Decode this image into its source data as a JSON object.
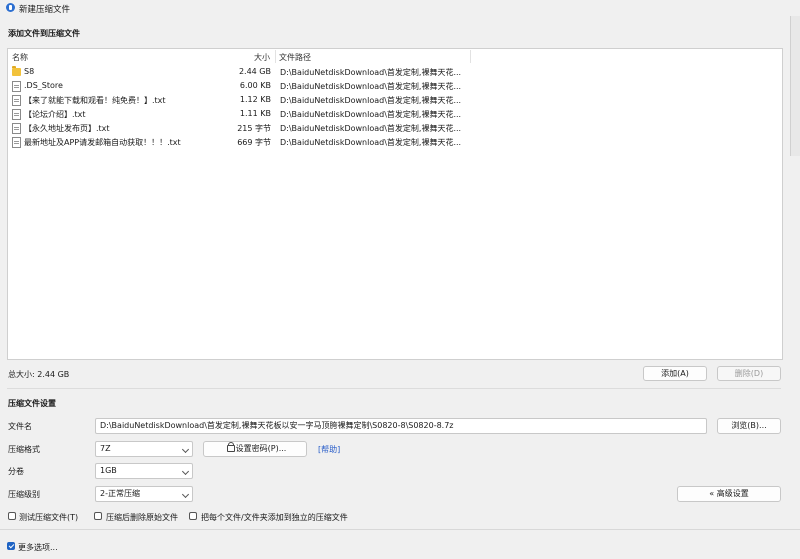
{
  "window": {
    "title": "新建压缩文件"
  },
  "add_section": {
    "heading": "添加文件到压缩文件",
    "columns": {
      "name": "名称",
      "size": "大小",
      "path": "文件路径"
    },
    "rows": [
      {
        "icon": "folder-icon",
        "name": "S8",
        "size": "2.44 GB",
        "path": "D:\\BaiduNetdiskDownload\\首发定制,裸舞天花..."
      },
      {
        "icon": "file-icon",
        "name": ".DS_Store",
        "size": "6.00 KB",
        "path": "D:\\BaiduNetdiskDownload\\首发定制,裸舞天花..."
      },
      {
        "icon": "text-file-icon",
        "name": "【来了就能下载和观看！纯免费！】.txt",
        "size": "1.12 KB",
        "path": "D:\\BaiduNetdiskDownload\\首发定制,裸舞天花..."
      },
      {
        "icon": "text-file-icon",
        "name": "【论坛介绍】.txt",
        "size": "1.11 KB",
        "path": "D:\\BaiduNetdiskDownload\\首发定制,裸舞天花..."
      },
      {
        "icon": "text-file-icon",
        "name": "【永久地址发布页】.txt",
        "size": "215 字节",
        "path": "D:\\BaiduNetdiskDownload\\首发定制,裸舞天花..."
      },
      {
        "icon": "text-file-icon",
        "name": "最新地址及APP请发邮箱自动获取！！！.txt",
        "size": "669 字节",
        "path": "D:\\BaiduNetdiskDownload\\首发定制,裸舞天花..."
      }
    ],
    "total_size": "总大小: 2.44 GB",
    "add_button": "添加(A)",
    "delete_button": "删除(D)"
  },
  "settings": {
    "heading": "压缩文件设置",
    "filename_label": "文件名",
    "filename_value": "D:\\BaiduNetdiskDownload\\首发定制,裸舞天花板以安一字马顶胯裸舞定制\\S0820-8\\S0820-8.7z",
    "browse_button": "浏览(B)...",
    "format_label": "压缩格式",
    "format_value": "7Z",
    "password_button": "设置密码(P)...",
    "help_link": "[帮助]",
    "split_label": "分卷",
    "split_value": "1GB",
    "level_label": "压缩级别",
    "level_value": "2-正常压缩",
    "advanced_button": "« 高级设置",
    "checkboxes": {
      "test": "测试压缩文件(T)",
      "delete_after": "压缩后删除原始文件",
      "each_separate": "把每个文件/文件夹添加到独立的压缩文件"
    }
  },
  "footer": {
    "more_options": "更多选项..."
  },
  "colors": {
    "accent": "#1e63c4",
    "link": "#2a5ec9",
    "folder": "#f2c23b"
  }
}
